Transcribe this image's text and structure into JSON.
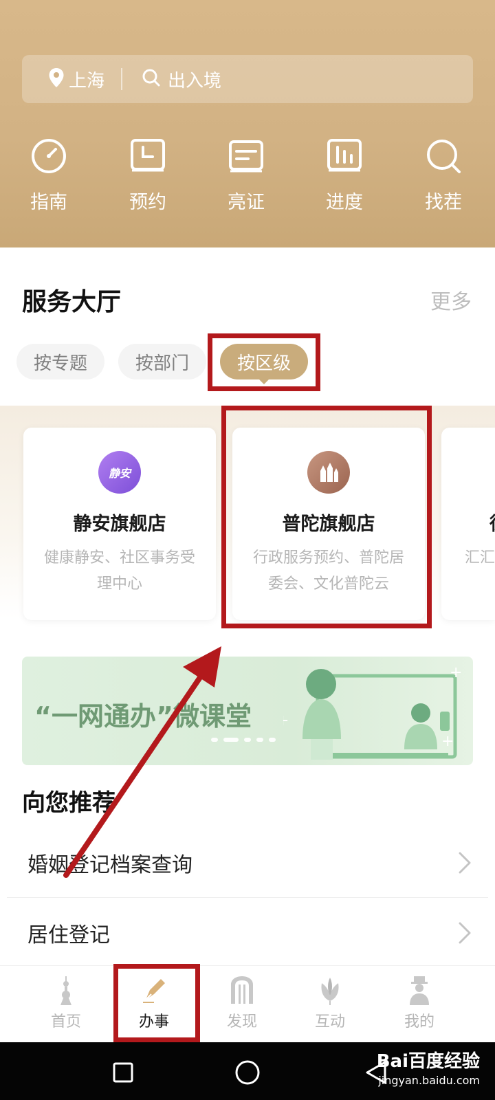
{
  "header": {
    "city": "上海",
    "search_placeholder": "出入境",
    "shortcuts": [
      {
        "label": "指南",
        "icon": "gauge-icon"
      },
      {
        "label": "预约",
        "icon": "clock-icon"
      },
      {
        "label": "亮证",
        "icon": "id-card-icon"
      },
      {
        "label": "进度",
        "icon": "bar-chart-icon"
      },
      {
        "label": "找茬",
        "icon": "magnifier-icon"
      }
    ]
  },
  "service_hall": {
    "title": "服务大厅",
    "more": "更多",
    "filters": [
      {
        "label": "按专题",
        "active": false
      },
      {
        "label": "按部门",
        "active": false
      },
      {
        "label": "按区级",
        "active": true
      }
    ],
    "cards": [
      {
        "name": "静安旗舰店",
        "desc": "健康静安、社区事务受理中心",
        "logo_text": "静安",
        "logo_color": "#9a63e6"
      },
      {
        "name": "普陀旗舰店",
        "desc": "行政服务预约、普陀居委会、文化普陀云",
        "logo_color": "#b07a63"
      },
      {
        "name": "徐",
        "desc": "汇汇、"
      }
    ]
  },
  "banner": {
    "text": "“一网通办”微课堂"
  },
  "recommend": {
    "title": "向您推荐",
    "items": [
      {
        "label": "婚姻登记档案查询"
      },
      {
        "label": "居住登记"
      }
    ]
  },
  "tabbar": {
    "tabs": [
      {
        "label": "首页",
        "icon": "tower-icon",
        "active": false
      },
      {
        "label": "办事",
        "icon": "pen-icon",
        "active": true
      },
      {
        "label": "发现",
        "icon": "arch-icon",
        "active": false
      },
      {
        "label": "互动",
        "icon": "magnolia-icon",
        "active": false
      },
      {
        "label": "我的",
        "icon": "person-icon",
        "active": false
      }
    ]
  },
  "watermark": {
    "line1": "Bai百度经验",
    "line2": "jingyan.baidu.com"
  },
  "colors": {
    "gold": "#c9ac7c",
    "annotation_red": "#b3191c",
    "banner_green": "#6f9a74"
  }
}
